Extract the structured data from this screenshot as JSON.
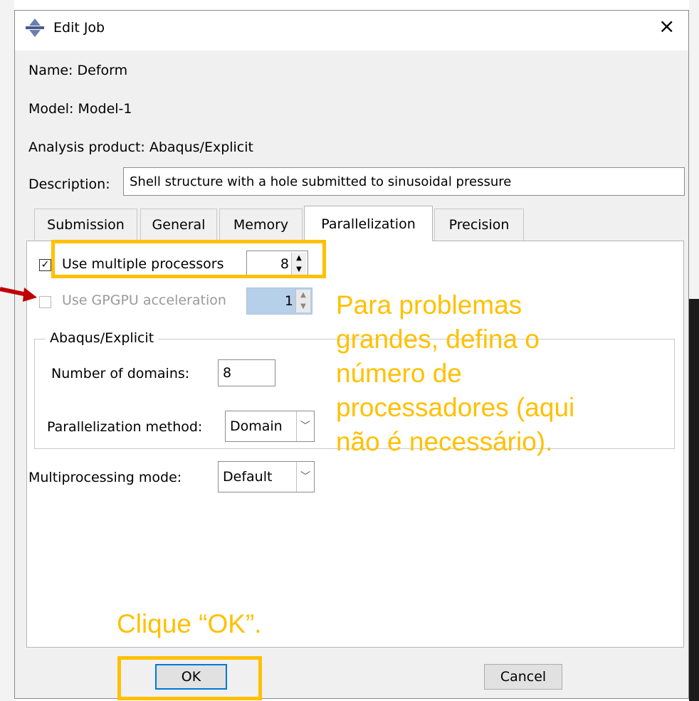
{
  "dialog": {
    "title": "Edit Job",
    "close_label": "×",
    "name_line": "Name:  Deform",
    "model_line": "Model:  Model-1",
    "product_line": "Analysis product:  Abaqus/Explicit",
    "description_label": "Description:",
    "description_value": "Shell structure with a hole submitted to sinusoidal pressure"
  },
  "tabs": [
    {
      "label": "Submission"
    },
    {
      "label": "General"
    },
    {
      "label": "Memory"
    },
    {
      "label": "Parallelization",
      "active": true
    },
    {
      "label": "Precision"
    }
  ],
  "parallelization": {
    "multi_proc_label": "Use multiple processors",
    "multi_proc_checked": true,
    "multi_proc_checkmark": "✓",
    "multi_proc_value": "8",
    "gpgpu_label": "Use GPGPU acceleration",
    "gpgpu_value": "1",
    "group_title": "Abaqus/Explicit",
    "domains_label": "Number of domains:",
    "domains_value": "8",
    "method_label": "Parallelization method:",
    "method_value": "Domain",
    "mode_label": "Multiprocessing mode:",
    "mode_value": "Default"
  },
  "buttons": {
    "ok": "OK",
    "cancel": "Cancel"
  },
  "annotations": {
    "note_processors": [
      "Para problemas",
      "grandes, defina o",
      "número de",
      "processadores (aqui",
      "não é necessário)."
    ],
    "note_ok": "Clique “OK”.",
    "highlight_color": "#ffc000",
    "arrow_color": "#c00000"
  },
  "icons": {
    "app": "abaqus-job-icon",
    "spin_up": "▲",
    "spin_down": "▼",
    "dropdown": "﹀"
  }
}
